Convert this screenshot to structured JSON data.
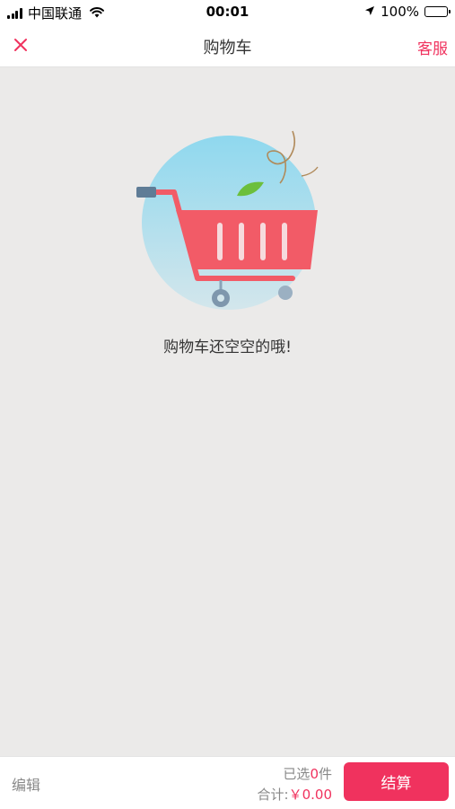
{
  "status_bar": {
    "carrier": "中国联通",
    "time": "00:01",
    "battery": "100%",
    "icons": [
      "signal-icon",
      "wifi-icon",
      "location-icon",
      "battery-icon"
    ]
  },
  "nav": {
    "close_icon": "close-icon",
    "title": "购物车",
    "service_label": "客服"
  },
  "empty_state": {
    "illustration": "empty-shopping-cart",
    "message": "购物车还空空的哦!"
  },
  "bottom_bar": {
    "edit_label": "编辑",
    "selected_prefix": "已选",
    "selected_count": "0",
    "selected_suffix": "件",
    "total_label": "合计:",
    "total_amount": "￥0.00",
    "checkout_label": "结算"
  },
  "colors": {
    "accent": "#f0325e",
    "background": "#ebeae9",
    "cart_red": "#f25b67",
    "circle_top": "#8fd8ee",
    "circle_bottom": "#cfe4ec",
    "leaf_green": "#6cbf3c"
  }
}
